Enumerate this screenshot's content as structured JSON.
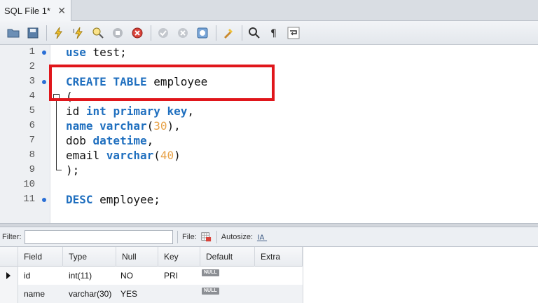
{
  "tab": {
    "title": "SQL File 1*",
    "close": "✕"
  },
  "toolbar": {
    "icons": [
      "open-folder-icon",
      "save-icon",
      "execute-icon",
      "execute-current-icon",
      "explain-icon",
      "stop-icon",
      "toggle-error-icon",
      "commit-icon",
      "rollback-icon",
      "autocommit-icon",
      "beautify-icon",
      "find-icon",
      "invisible-chars-icon",
      "wrap-icon"
    ]
  },
  "editor": {
    "lines": [
      {
        "n": "1"
      },
      {
        "n": "2"
      },
      {
        "n": "3"
      },
      {
        "n": "4"
      },
      {
        "n": "5"
      },
      {
        "n": "6"
      },
      {
        "n": "7"
      },
      {
        "n": "8"
      },
      {
        "n": "9"
      },
      {
        "n": "10"
      },
      {
        "n": "11"
      }
    ],
    "code": {
      "l1_kw": "use",
      "l1_rest": " test;",
      "l3_kw": "CREATE TABLE",
      "l3_rest": " employee",
      "l4": "(",
      "l5_a": "id ",
      "l5_kw1": "int",
      "l5_sp": " ",
      "l5_kw2": "primary key",
      "l5_end": ",",
      "l6_kw": "name",
      "l6_sp": " ",
      "l6_kw2": "varchar",
      "l6_p1": "(",
      "l6_num": "30",
      "l6_p2": "),",
      "l7_a": "dob ",
      "l7_kw": "datetime",
      "l7_end": ",",
      "l8_a": "email ",
      "l8_kw": "varchar",
      "l8_p1": "(",
      "l8_num": "40",
      "l8_p2": ")",
      "l9": ");",
      "l11_kw": "DESC",
      "l11_rest": " employee;"
    }
  },
  "filterbar": {
    "filter_label": "Filter:",
    "filter_value": "",
    "file_label": "File:",
    "autosize_label": "Autosize:"
  },
  "grid": {
    "columns": [
      "Field",
      "Type",
      "Null",
      "Key",
      "Default",
      "Extra"
    ],
    "rows": [
      {
        "field": "id",
        "type": "int(11)",
        "null": "NO",
        "key": "PRI",
        "default": "NULL",
        "extra": ""
      },
      {
        "field": "name",
        "type": "varchar(30)",
        "null": "YES",
        "key": "",
        "default": "NULL",
        "extra": ""
      }
    ]
  },
  "colors": {
    "keyword": "#1f6fbf",
    "number": "#e8a34a",
    "highlight": "#e0161b"
  }
}
